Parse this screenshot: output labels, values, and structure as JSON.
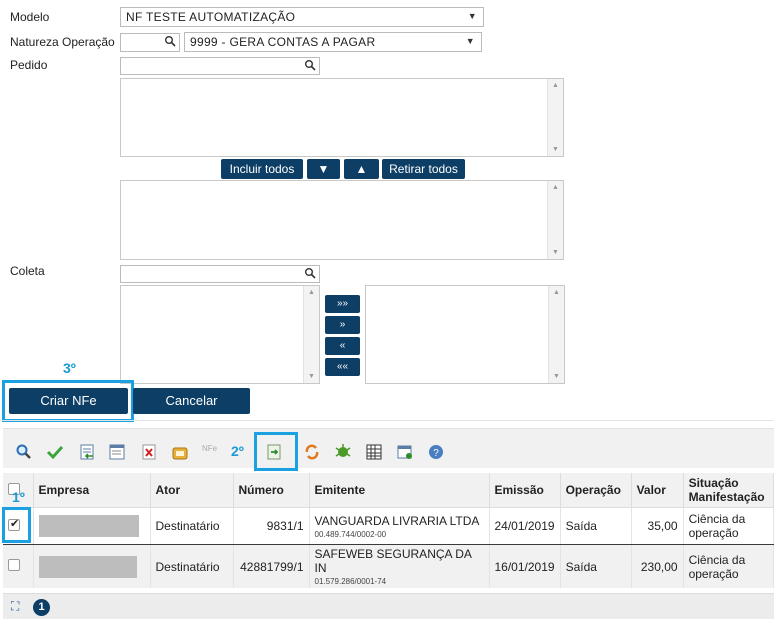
{
  "form": {
    "modelo_label": "Modelo",
    "modelo_value": "NF TESTE AUTOMATIZAÇÃO",
    "natureza_label": "Natureza Operação",
    "natureza_value": "9999 - GERA CONTAS A PAGAR",
    "pedido_label": "Pedido",
    "coleta_label": "Coleta",
    "incluir_todos": "Incluir todos",
    "down_arrow": "▼",
    "up_arrow": "▲",
    "retirar_todos": "Retirar todos",
    "move_all_right": "»»",
    "move_right": "»",
    "move_left": "«",
    "move_all_left": "««"
  },
  "actions": {
    "criar_nfe": "Criar NFe",
    "cancelar": "Cancelar"
  },
  "annotations": {
    "step1": "1º",
    "step2": "2º",
    "step3": "3º"
  },
  "toolbar": {
    "nfe_icon_text": "NFe",
    "icons": [
      "search-icon",
      "check-icon",
      "import-icon",
      "list-icon",
      "delete-icon",
      "lock-icon",
      "nfe-icon",
      "generate-nfe-icon",
      "refresh-icon",
      "bug-icon",
      "grid-icon",
      "user-icon",
      "calendar-icon",
      "help-icon"
    ]
  },
  "table": {
    "headers": {
      "empresa": "Empresa",
      "ator": "Ator",
      "numero": "Número",
      "emitente": "Emitente",
      "emissao": "Emissão",
      "operacao": "Operação",
      "valor": "Valor",
      "situacao1": "Situação",
      "situacao2": "Manifestação"
    },
    "rows": [
      {
        "checked": true,
        "ator": "Destinatário",
        "numero": "9831/1",
        "emitente": "VANGUARDA LIVRARIA LTDA",
        "cnpj": "00.489.744/0002-00",
        "emissao": "24/01/2019",
        "operacao": "Saída",
        "valor": "35,00",
        "situacao1": "Ciência da",
        "situacao2": "operação"
      },
      {
        "checked": false,
        "ator": "Destinatário",
        "numero": "42881799/1",
        "emitente": "SAFEWEB SEGURANÇA DA IN",
        "cnpj": "01.579.286/0001-74",
        "emissao": "16/01/2019",
        "operacao": "Saída",
        "valor": "230,00",
        "situacao1": "Ciência da",
        "situacao2": "operação"
      }
    ]
  },
  "footer": {
    "page": "1"
  },
  "colors": {
    "button": "#0d3e66",
    "highlight": "#1ba1e2"
  }
}
